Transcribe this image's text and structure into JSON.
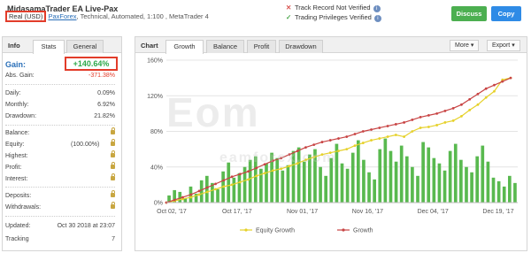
{
  "header": {
    "title": "MidasamaTrader EA Live-Pax",
    "account_type": "Real (USD)",
    "broker": "PaxForex",
    "details": ", Technical, Automated, 1:100 , MetaTrader 4",
    "track_record": "Track Record Not Verified",
    "trading_privileges": "Trading Privileges Verified",
    "discuss_label": "Discuss",
    "copy_label": "Copy"
  },
  "info_panel": {
    "title": "Info",
    "tabs": [
      "Stats",
      "General"
    ],
    "gain_label": "Gain:",
    "gain_value": "+140.64%",
    "abs_gain_label": "Abs. Gain:",
    "abs_gain_value": "-371.38%",
    "daily_label": "Daily:",
    "daily_value": "0.09%",
    "monthly_label": "Monthly:",
    "monthly_value": "6.92%",
    "drawdown_label": "Drawdown:",
    "drawdown_value": "21.82%",
    "balance_label": "Balance:",
    "equity_label": "Equity:",
    "equity_pct": "(100.00%)",
    "highest_label": "Highest:",
    "profit_label": "Profit:",
    "interest_label": "Interest:",
    "deposits_label": "Deposits:",
    "withdrawals_label": "Withdrawals:",
    "updated_label": "Updated:",
    "updated_value": "Oct 30 2018 at 23:07",
    "tracking_label": "Tracking",
    "tracking_value": "7"
  },
  "chart_panel": {
    "title": "Chart",
    "tabs": [
      "Growth",
      "Balance",
      "Profit",
      "Drawdown"
    ],
    "more_label": "More",
    "export_label": "Export"
  },
  "watermark": {
    "main": "Eom",
    "sub": "eamforex.com"
  },
  "colors": {
    "equity": "#e6d12a",
    "growth": "#c84444",
    "bars": "#59b94f",
    "accent_red": "#e23c2a",
    "gain_green": "#2da84a"
  },
  "chart_data": {
    "type": "line",
    "x_ticks": [
      "Oct 02, '17",
      "Oct 17, '17",
      "Nov 01, '17",
      "Nov 16, '17",
      "Dec 04, '17",
      "Dec 19, '17"
    ],
    "ylim": [
      0,
      160
    ],
    "y_ticks": [
      "0%",
      "40%",
      "80%",
      "120%",
      "160%"
    ],
    "grid": true,
    "legend_position": "bottom",
    "series": [
      {
        "name": "Equity Growth",
        "values": [
          0,
          2,
          4,
          6,
          9,
          12,
          15,
          18,
          20,
          23,
          26,
          30,
          33,
          36,
          38,
          41,
          44,
          48,
          51,
          54,
          56,
          58,
          60,
          64,
          67,
          70,
          72,
          74,
          76,
          74,
          80,
          84,
          85,
          87,
          90,
          92,
          97,
          104,
          110,
          118,
          125,
          138,
          140
        ]
      },
      {
        "name": "Growth",
        "values": [
          0,
          3,
          6,
          9,
          13,
          17,
          21,
          25,
          29,
          32,
          35,
          39,
          43,
          47,
          50,
          54,
          58,
          62,
          65,
          68,
          70,
          72,
          74,
          77,
          80,
          82,
          84,
          86,
          88,
          90,
          93,
          96,
          98,
          100,
          103,
          106,
          110,
          116,
          122,
          128,
          132,
          136,
          140
        ]
      }
    ],
    "bars": [
      8,
      14,
      12,
      5,
      18,
      10,
      25,
      30,
      22,
      15,
      35,
      45,
      28,
      33,
      40,
      48,
      52,
      38,
      44,
      56,
      50,
      36,
      42,
      58,
      62,
      46,
      54,
      60,
      40,
      30,
      50,
      66,
      44,
      38,
      56,
      70,
      48,
      34,
      26,
      60,
      72,
      58,
      46,
      64,
      52,
      40,
      30,
      68,
      62,
      50,
      44,
      36,
      58,
      66,
      48,
      40,
      34,
      52,
      64,
      46,
      28,
      24,
      18,
      30,
      22
    ]
  }
}
